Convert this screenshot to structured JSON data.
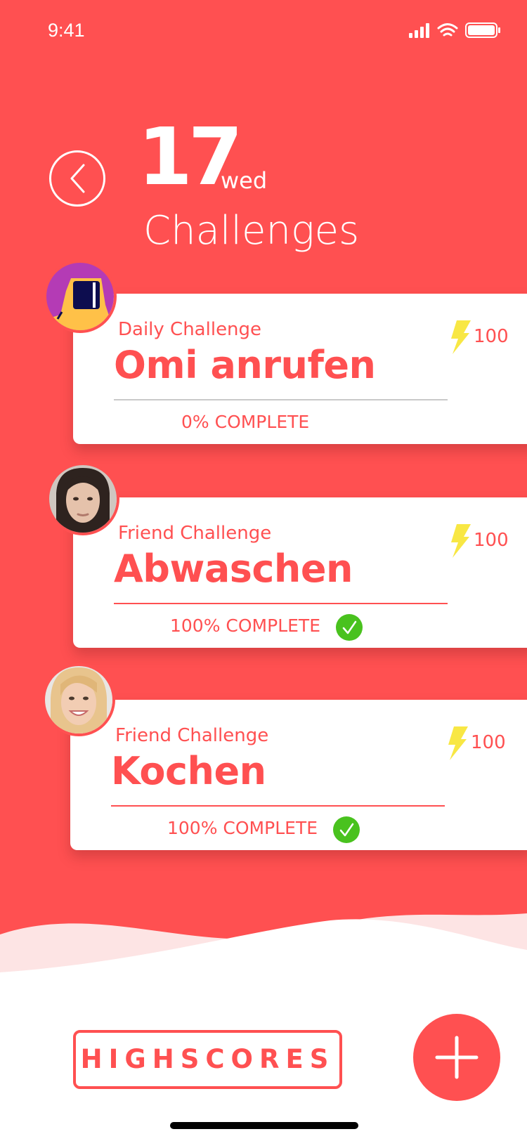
{
  "status_bar": {
    "time": "9:41"
  },
  "header": {
    "day_number": "17",
    "day_name": "wed",
    "title": "Challenges"
  },
  "challenges": [
    {
      "type": "Daily Challenge",
      "title": "Omi anrufen",
      "points": "100",
      "progress_label": "0% COMPLETE",
      "progress": 0,
      "completed": false,
      "avatar": "app-icon-avatar"
    },
    {
      "type": "Friend Challenge",
      "title": "Abwaschen",
      "points": "100",
      "progress_label": "100% COMPLETE",
      "progress": 1,
      "completed": true,
      "avatar": "woman-photo-avatar"
    },
    {
      "type": "Friend Challenge",
      "title": "Kochen",
      "points": "100",
      "progress_label": "100% COMPLETE",
      "progress": 1,
      "completed": true,
      "avatar": "blonde-woman-photo-avatar"
    }
  ],
  "footer": {
    "highscores_label": "HIGHSCORES",
    "add_icon": "plus-icon"
  },
  "colors": {
    "primary": "#FF5051",
    "bolt": "#F8E744",
    "check": "#49C21E"
  }
}
